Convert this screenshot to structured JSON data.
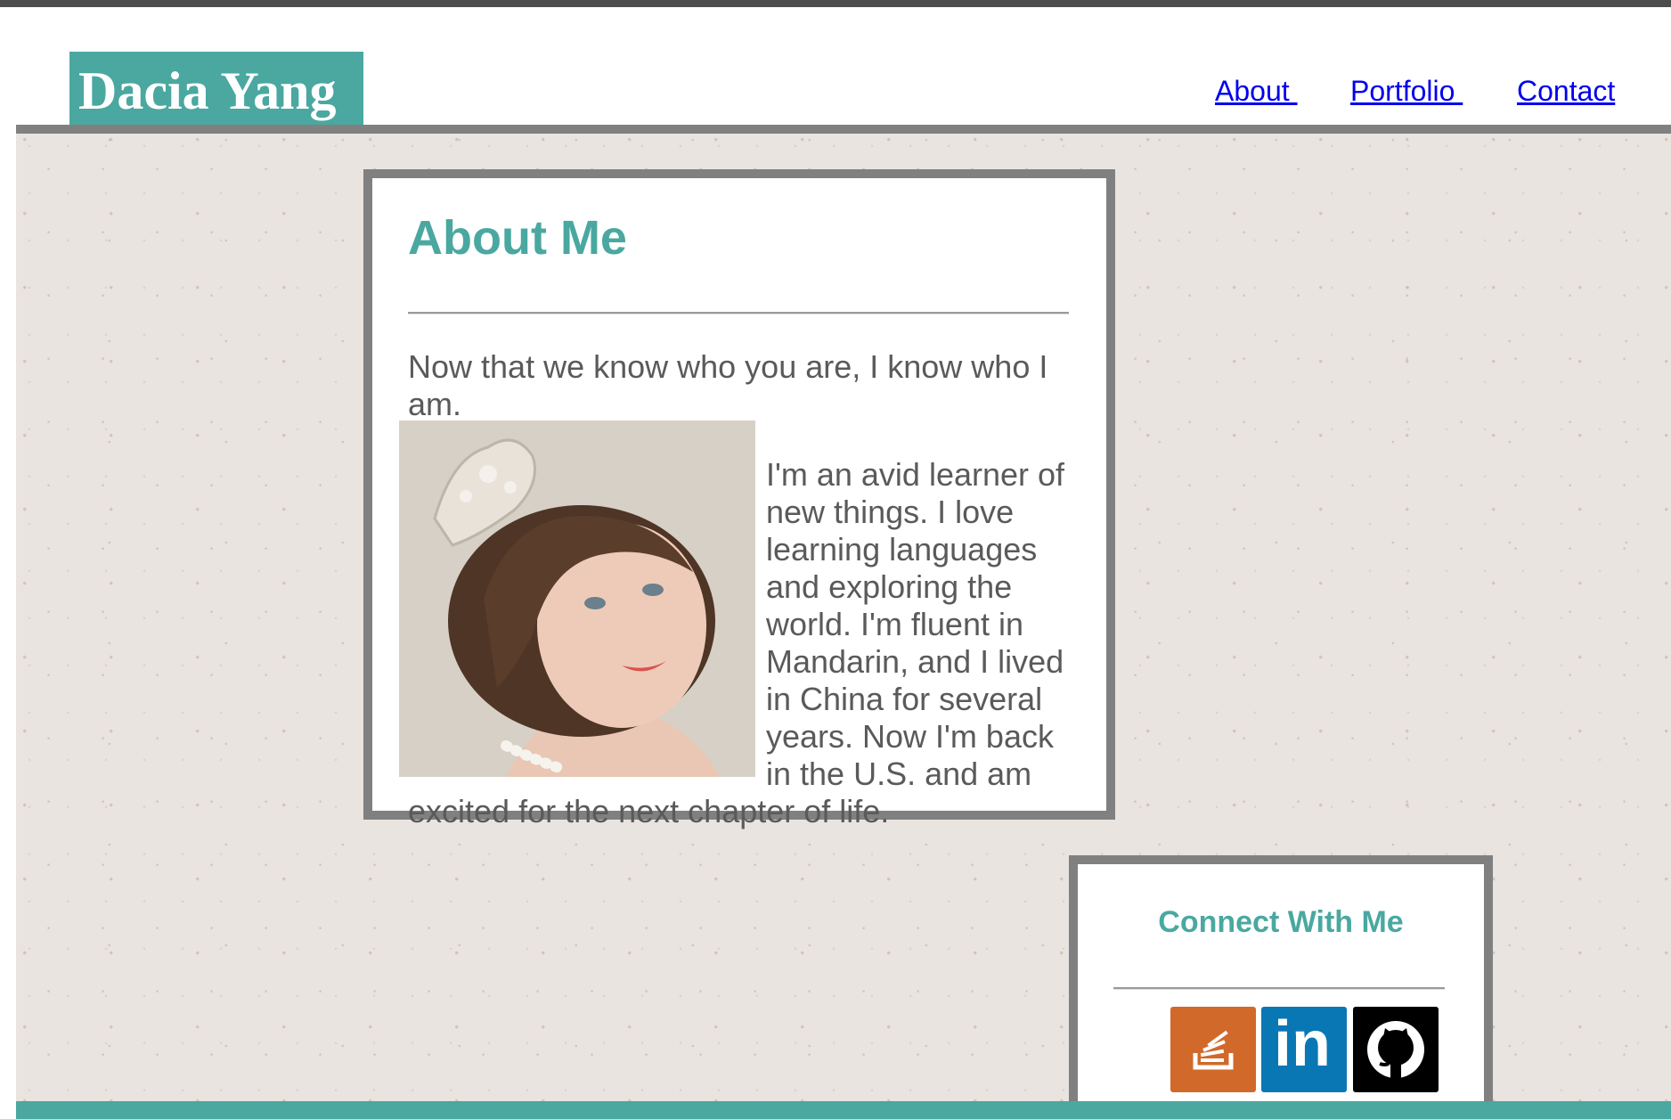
{
  "header": {
    "brand_name": "Dacia Yang",
    "nav": [
      {
        "label": "About "
      },
      {
        "label": "Portfolio "
      },
      {
        "label": "Contact"
      }
    ]
  },
  "about": {
    "title": "About Me",
    "intro": "Now that we know who you are, I know who I am.",
    "bio": "I'm an avid learner of new things. I love learning languages and exploring the world. I'm fluent in Mandarin, and I lived in China for several years. Now I'm back in the U.S. and am excited for the next chapter of life.",
    "photo_icon": "portrait-photo"
  },
  "connect": {
    "title": "Connect With Me",
    "links": [
      {
        "icon": "stackoverflow-icon",
        "color": "#d1692a"
      },
      {
        "icon": "linkedin-icon",
        "color": "#0a77b5",
        "text": "in"
      },
      {
        "icon": "github-icon",
        "color": "#000000"
      }
    ]
  },
  "colors": {
    "accent": "#4aa8a0",
    "border": "#808080",
    "link": "#0000ee",
    "body_text": "#5a5a5a"
  }
}
